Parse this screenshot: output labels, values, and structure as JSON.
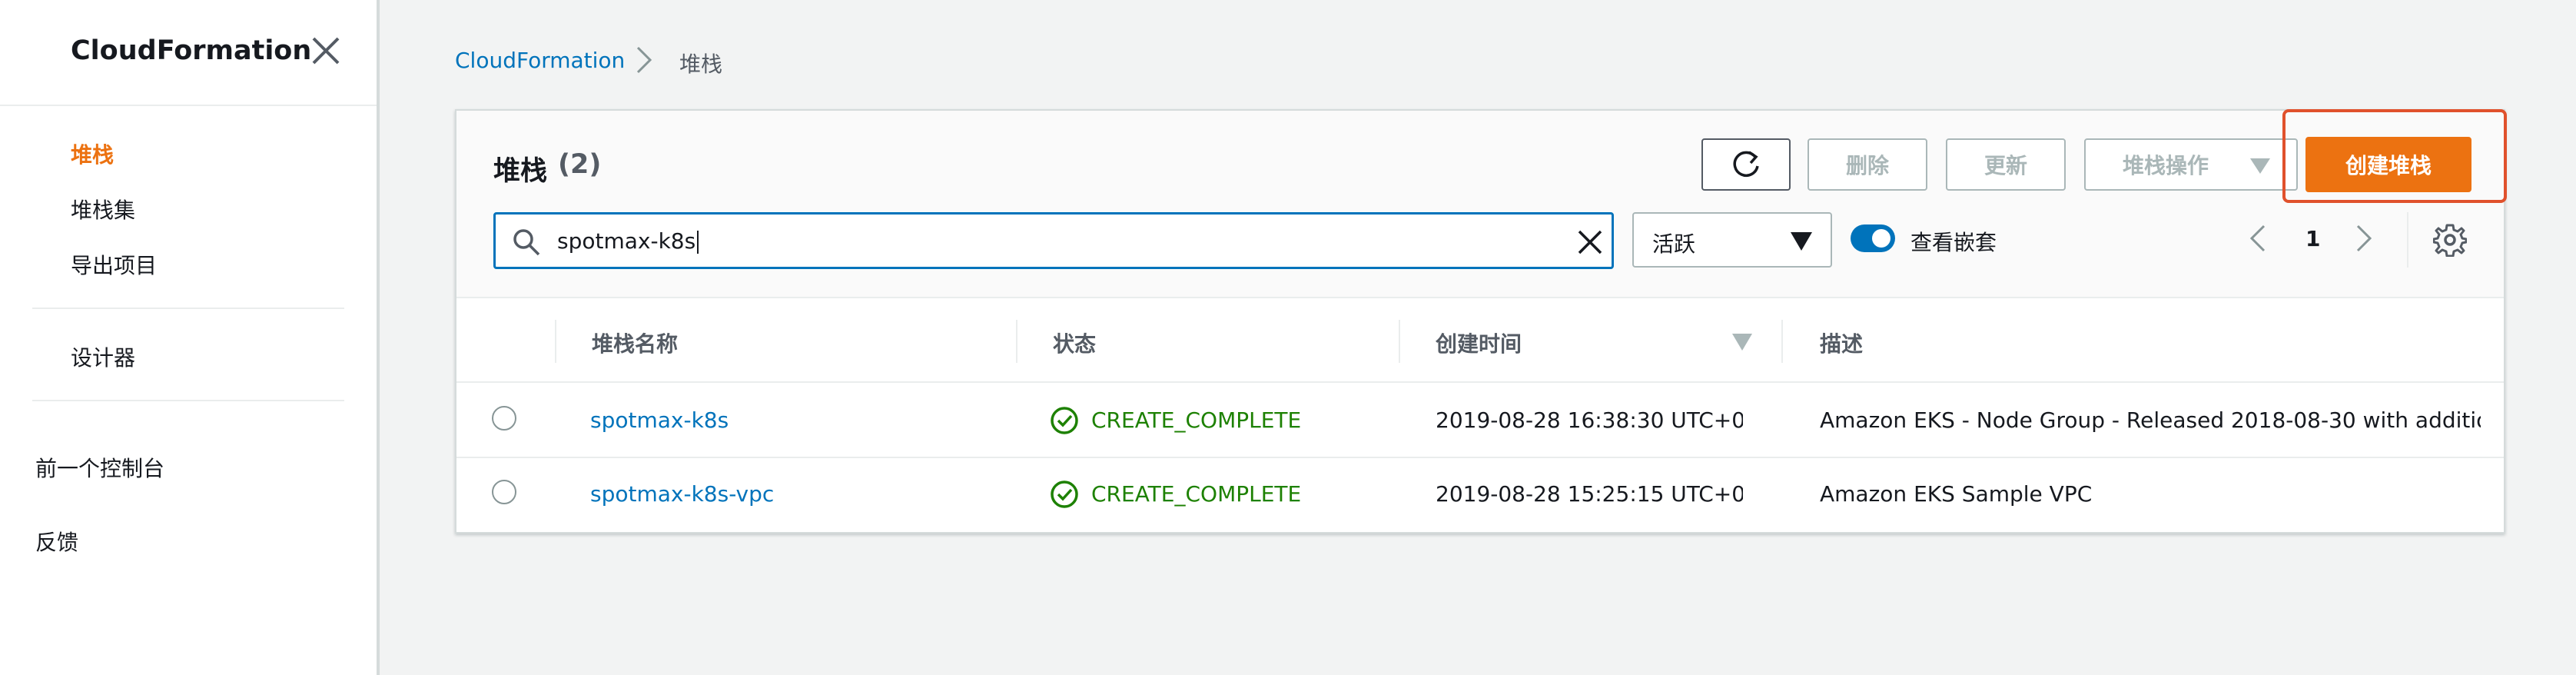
{
  "sidebar": {
    "title": "CloudFormation",
    "items": [
      {
        "label": "堆栈",
        "active": true
      },
      {
        "label": "堆栈集"
      },
      {
        "label": "导出项目"
      },
      {
        "label": "设计器"
      },
      {
        "label": "前一个控制台"
      },
      {
        "label": "反馈"
      }
    ]
  },
  "breadcrumb": {
    "root": "CloudFormation",
    "current": "堆栈"
  },
  "panel": {
    "title": "堆栈",
    "count": "(2)",
    "buttons": {
      "delete": "删除",
      "update": "更新",
      "stack_actions": "堆栈操作",
      "create": "创建堆栈"
    },
    "search": {
      "value": "spotmax-k8s"
    },
    "filter": {
      "selected": "活跃"
    },
    "toggle": {
      "label": "查看嵌套",
      "on": true
    },
    "pagination": {
      "page": "1"
    }
  },
  "table": {
    "columns": [
      "堆栈名称",
      "状态",
      "创建时间",
      "描述"
    ],
    "rows": [
      {
        "name": "spotmax-k8s",
        "status": "CREATE_COMPLETE",
        "created": "2019-08-28 16:38:30 UTC+0…",
        "description": "Amazon EKS - Node Group - Released 2018-08-30 with addition…"
      },
      {
        "name": "spotmax-k8s-vpc",
        "status": "CREATE_COMPLETE",
        "created": "2019-08-28 15:25:15 UTC+0…",
        "description": "Amazon EKS Sample VPC"
      }
    ]
  },
  "colors": {
    "accent": "#ec7211",
    "link": "#0073bb",
    "success": "#1d8102",
    "highlight": "#e0512c"
  }
}
